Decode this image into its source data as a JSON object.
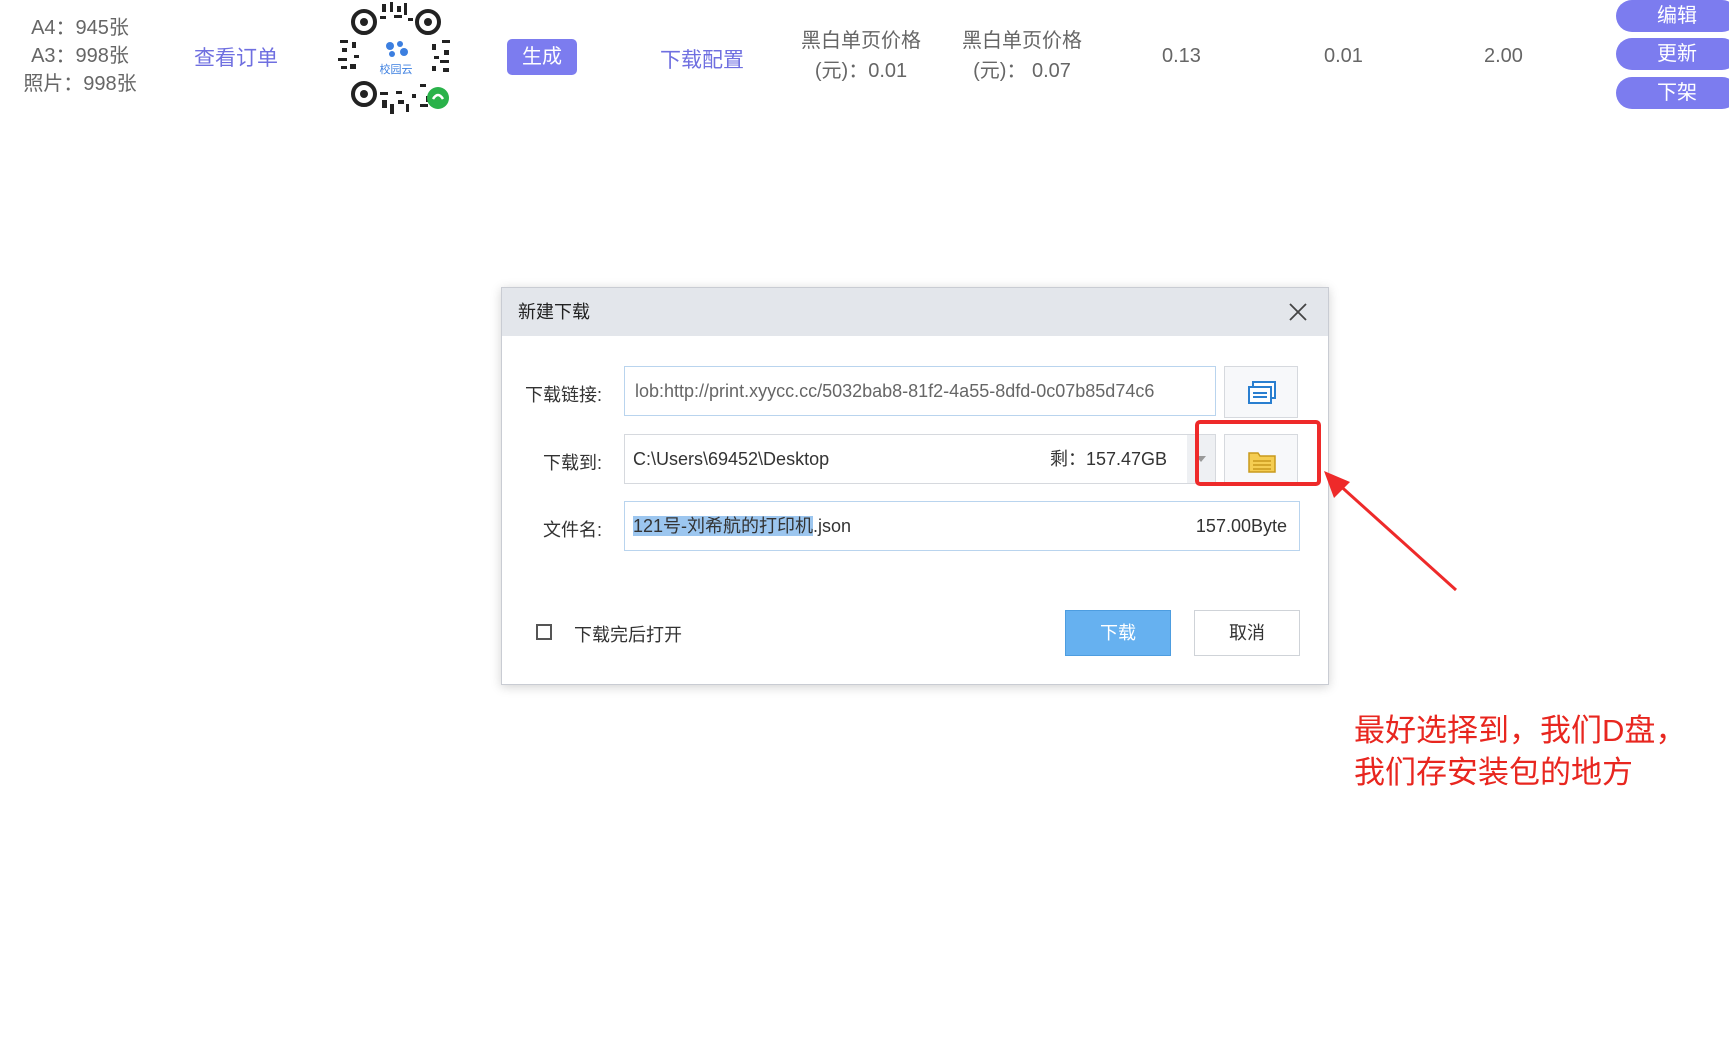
{
  "table_row": {
    "paper_counts": [
      "A4：945张",
      "A3：998张",
      "照片：998张"
    ],
    "view_orders_link": "查看订单",
    "qr_logo_text": "校园云",
    "generate_button": "生成",
    "download_config_link": "下载配置",
    "bw_price_1": [
      "黑白单页价格",
      "(元)：0.01"
    ],
    "bw_price_2": [
      "黑白单页价格",
      "(元)：  0.07"
    ],
    "value_1": "0.13",
    "value_2": "0.01",
    "value_3": "2.00",
    "actions": [
      "编辑",
      "更新",
      "下架"
    ]
  },
  "dialog": {
    "title": "新建下载",
    "url_label": "下载链接:",
    "url_value": "lob:http://print.xyycc.cc/5032bab8-81f2-4a55-8dfd-0c07b85d74c6",
    "dest_label": "下载到:",
    "dest_value": "C:\\Users\\69452\\Desktop",
    "free_space": "剩：157.47GB",
    "filename_label": "文件名:",
    "filename_selected": "121号-刘希航的打印机",
    "filename_ext": ".json",
    "file_size": "157.00Byte",
    "open_after_label": "下载完后打开",
    "open_after_checked": false,
    "download_button": "下载",
    "cancel_button": "取消"
  },
  "annotation": {
    "line1": "最好选择到，我们D盘，",
    "line2": "我们存安装包的地方",
    "color": "#e8261f"
  },
  "colors": {
    "accent": "#7c7cef",
    "primary_button": "#66b1f0",
    "annotation_red": "#ee2a2a"
  }
}
